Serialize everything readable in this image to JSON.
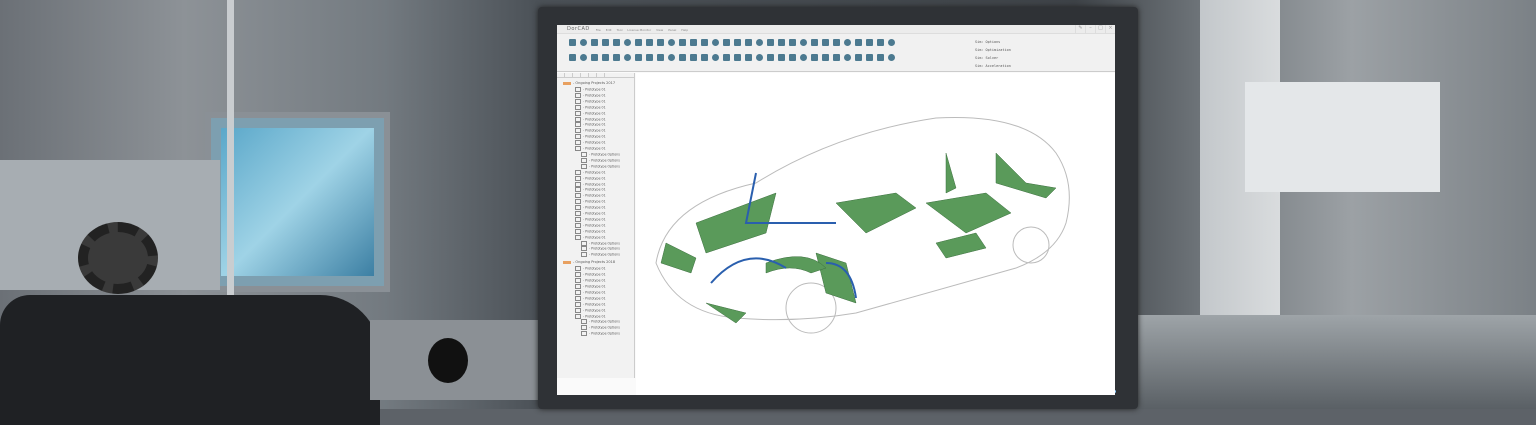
{
  "app": {
    "title": "DorCAD",
    "menu": [
      "File",
      "Edit",
      "Tool",
      "License Monitor",
      "View",
      "Panel",
      "Help"
    ]
  },
  "sim_menu": [
    "Sim: Options",
    "Sim: Optimization",
    "Sim: Solver",
    "Sim: Acceleration"
  ],
  "tree": [
    {
      "label": "- Ongoing Projects 2017",
      "items": [
        "- Prototype 01",
        "- Prototype 01",
        "- Prototype 01",
        "- Prototype 01",
        "- Prototype 01",
        "- Prototype 01",
        "- Prototype 01",
        "- Prototype 01",
        "- Prototype 01",
        "- Prototype 01",
        "- Prototype 01"
      ],
      "options": [
        "- Prototype Options",
        "- Prototype Options",
        "- Prototype Options"
      ],
      "items2": [
        "- Prototype 01",
        "- Prototype 01",
        "- Prototype 01",
        "- Prototype 01",
        "- Prototype 01",
        "- Prototype 01",
        "- Prototype 01",
        "- Prototype 01",
        "- Prototype 01",
        "- Prototype 01",
        "- Prototype 01",
        "- Prototype 01"
      ],
      "options2": [
        "- Prototype Options",
        "- Prototype Options",
        "- Prototype Options"
      ]
    },
    {
      "label": "- Ongoing Projects 2018",
      "items": [
        "- Prototype 01",
        "- Prototype 01",
        "- Prototype 01",
        "- Prototype 01",
        "- Prototype 01",
        "- Prototype 01",
        "- Prototype 01",
        "- Prototype 01",
        "- Prototype 01"
      ],
      "options": [
        "- Prototype Options",
        "- Prototype Options",
        "- Prototype Options"
      ]
    }
  ],
  "colors": {
    "part_green": "#5a9a5a",
    "accent_blue": "#2a5fae",
    "icon": "#4c7a90"
  }
}
